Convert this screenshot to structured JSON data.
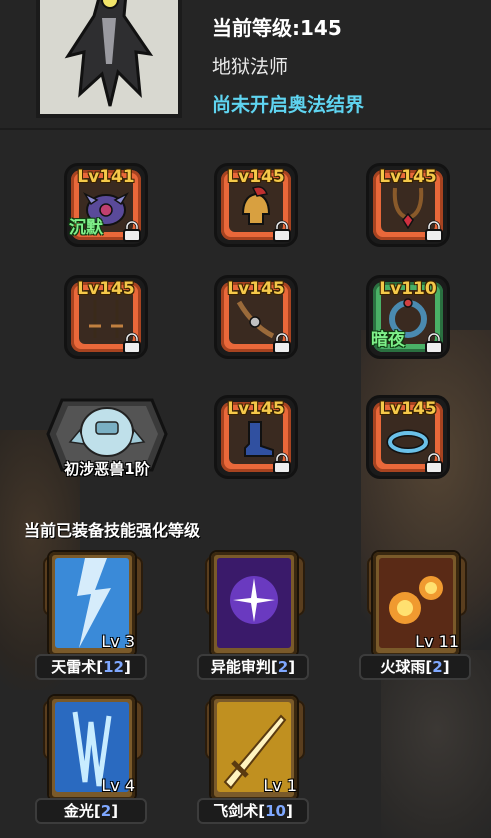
{
  "header": {
    "level_text": "当前等级:145",
    "class_name": "地狱法师",
    "arcane_status": "尚未开启奥法结界",
    "arcane_color": "#5fd4f0"
  },
  "equipment": [
    {
      "level": "Lv141",
      "icon": "spiked-helmet-icon",
      "tag": "沉默",
      "locked": true
    },
    {
      "level": "Lv145",
      "icon": "crested-helmet-icon",
      "tag": "",
      "locked": true
    },
    {
      "level": "Lv145",
      "icon": "ruby-amulet-icon",
      "tag": "",
      "locked": true
    },
    {
      "level": "Lv145",
      "icon": "twin-swords-icon",
      "tag": "",
      "locked": true
    },
    {
      "level": "Lv145",
      "icon": "leather-belt-icon",
      "tag": "",
      "locked": true
    },
    {
      "level": "Lv110",
      "icon": "rune-ring-icon",
      "tag": "暗夜",
      "locked": true
    },
    {
      "level": "Lv145",
      "icon": "boot-icon",
      "tag": "",
      "locked": true
    },
    {
      "level": "Lv145",
      "icon": "blue-ring-icon",
      "tag": "",
      "locked": true
    }
  ],
  "rune": {
    "label": "初涉恶兽1阶",
    "icon": "ice-golem-icon"
  },
  "skills_title": "当前已装备技能强化等级",
  "skills": [
    {
      "name": "天雷术",
      "count": "12",
      "level": "Lv 3",
      "icon": "lightning-icon"
    },
    {
      "name": "异能审判",
      "count": "2",
      "level": "",
      "icon": "purple-judgment-icon"
    },
    {
      "name": "火球雨",
      "count": "2",
      "level": "Lv 11",
      "icon": "fireball-icon"
    },
    {
      "name": "金光",
      "count": "2",
      "level": "Lv 4",
      "icon": "ice-crystal-icon"
    },
    {
      "name": "飞剑术",
      "count": "10",
      "level": "Lv 1",
      "icon": "flying-sword-icon"
    }
  ],
  "colors": {
    "slot_orange": "#e9683a",
    "level_gold": "#f5c94a",
    "tag_green": "#7ff08a",
    "skill_count_blue": "#7fa8ff"
  }
}
